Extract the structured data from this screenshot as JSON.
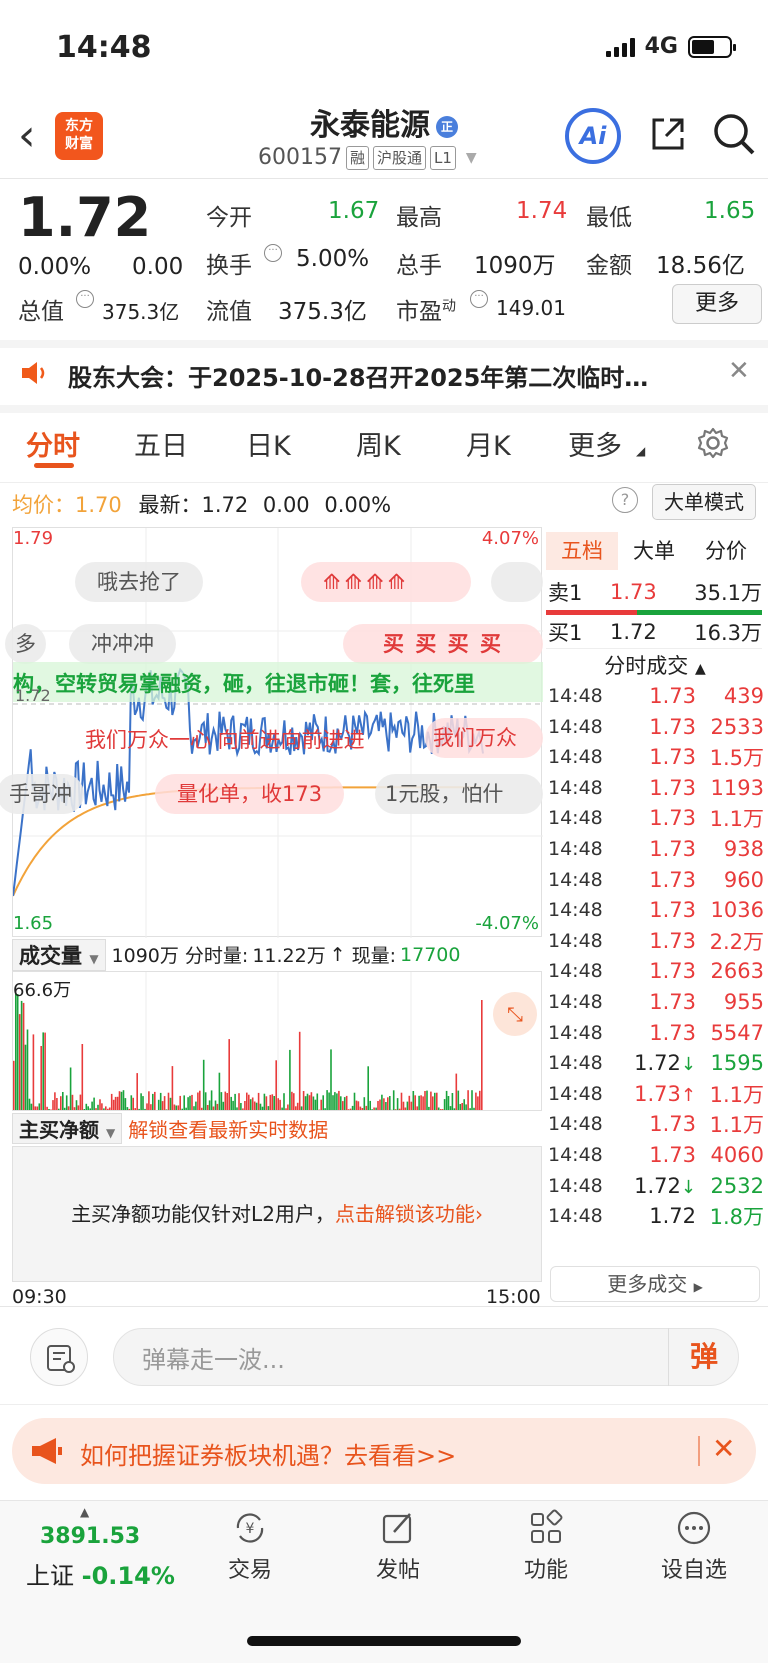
{
  "status": {
    "time": "14:48",
    "network": "4G"
  },
  "header": {
    "logo_line1": "东方",
    "logo_line2": "财富",
    "stock_name": "永泰能源",
    "name_badge": "正",
    "stock_code": "600157",
    "tags": [
      "融",
      "沪股通",
      "L1"
    ],
    "ai_label": "Ai"
  },
  "quote": {
    "price": "1.72",
    "change_pct": "0.00%",
    "change": "0.00",
    "open_label": "今开",
    "open": "1.67",
    "high_label": "最高",
    "high": "1.74",
    "low_label": "最低",
    "low": "1.65",
    "turnover_label": "换手",
    "turnover": "5.00%",
    "volume_label": "总手",
    "volume": "1090万",
    "amount_label": "金额",
    "amount": "18.56亿",
    "mktcap_label": "总值",
    "mktcap": "375.3亿",
    "float_label": "流值",
    "float": "375.3亿",
    "pe_label": "市盈",
    "pe_sup": "动",
    "pe": "149.01",
    "more_label": "更多"
  },
  "notice": {
    "text": "股东大会：于2025-10-28召开2025年第二次临时…"
  },
  "tabs": [
    "分时",
    "五日",
    "日K",
    "周K",
    "月K",
    "更多"
  ],
  "avg_row": {
    "avg_label": "均价：",
    "avg": "1.70",
    "latest_label": "最新：",
    "latest": "1.72",
    "chg": "0.00",
    "chg_pct": "0.00%"
  },
  "big_order_btn": "大单模式",
  "chart": {
    "y_max": "1.79",
    "y_min": "1.65",
    "pct_max": "4.07%",
    "pct_min": "-4.07%",
    "ref": "1.72",
    "time_start": "09:30",
    "time_end": "15:00"
  },
  "danmu": {
    "d1": "哦去抢了",
    "d2": "冲冲冲",
    "d3": "多",
    "d4": "量化单，收173",
    "d5": "1元股，怕什",
    "d6": "构，空转贸易掌融资，砸，往退市砸！套，往死里",
    "d7": "我们万众一心 向前进向前进进",
    "d8": "我们万众",
    "d9": "手哥冲",
    "d10_char": "买",
    "d11_char": "买"
  },
  "volume": {
    "selector": "成交量",
    "total": "1090万",
    "minute_label": "分时量:",
    "minute": "11.22万",
    "arrow": "↑",
    "now_label": "现量:",
    "now": "17700",
    "max": "66.6万"
  },
  "net_buy": {
    "selector": "主买净额",
    "unlock": "解锁查看最新实时数据",
    "msg": "主买净额功能仅针对L2用户，",
    "msg_link": "点击解锁该功能"
  },
  "right_panel": {
    "tabs": [
      "五档",
      "大单",
      "分价"
    ],
    "sell1_label": "卖1",
    "sell1_price": "1.73",
    "sell1_vol": "35.1万",
    "buy1_label": "买1",
    "buy1_price": "1.72",
    "buy1_vol": "16.3万",
    "ticks_title": "分时成交",
    "ticks": [
      {
        "t": "14:48",
        "p": "1.73",
        "v": "439",
        "c": "red",
        "a": ""
      },
      {
        "t": "14:48",
        "p": "1.73",
        "v": "2533",
        "c": "red",
        "a": ""
      },
      {
        "t": "14:48",
        "p": "1.73",
        "v": "1.5万",
        "c": "red",
        "a": ""
      },
      {
        "t": "14:48",
        "p": "1.73",
        "v": "1193",
        "c": "red",
        "a": ""
      },
      {
        "t": "14:48",
        "p": "1.73",
        "v": "1.1万",
        "c": "red",
        "a": ""
      },
      {
        "t": "14:48",
        "p": "1.73",
        "v": "938",
        "c": "red",
        "a": ""
      },
      {
        "t": "14:48",
        "p": "1.73",
        "v": "960",
        "c": "red",
        "a": ""
      },
      {
        "t": "14:48",
        "p": "1.73",
        "v": "1036",
        "c": "red",
        "a": ""
      },
      {
        "t": "14:48",
        "p": "1.73",
        "v": "2.2万",
        "c": "red",
        "a": ""
      },
      {
        "t": "14:48",
        "p": "1.73",
        "v": "2663",
        "c": "red",
        "a": ""
      },
      {
        "t": "14:48",
        "p": "1.73",
        "v": "955",
        "c": "red",
        "a": ""
      },
      {
        "t": "14:48",
        "p": "1.73",
        "v": "5547",
        "c": "red",
        "a": ""
      },
      {
        "t": "14:48",
        "p": "1.72",
        "v": "1595",
        "c": "green",
        "a": "↓"
      },
      {
        "t": "14:48",
        "p": "1.73",
        "v": "1.1万",
        "c": "red",
        "a": "↑"
      },
      {
        "t": "14:48",
        "p": "1.73",
        "v": "1.1万",
        "c": "red",
        "a": ""
      },
      {
        "t": "14:48",
        "p": "1.73",
        "v": "4060",
        "c": "red",
        "a": ""
      },
      {
        "t": "14:48",
        "p": "1.72",
        "v": "2532",
        "c": "green",
        "a": "↓"
      },
      {
        "t": "14:48",
        "p": "1.72",
        "v": "1.8万",
        "c": "green",
        "a": ""
      }
    ],
    "more_ticks": "更多成交"
  },
  "comment": {
    "placeholder": "弹幕走一波...",
    "button": "弹"
  },
  "promo": {
    "text": "如何把握证券板块机遇？去看看>>"
  },
  "bottom_nav": {
    "index_value": "3891.53",
    "index_name": "上证",
    "index_change": "-0.14%",
    "items": [
      "交易",
      "发帖",
      "功能",
      "设自选"
    ]
  },
  "colors": {
    "up": "#e83b3b",
    "down": "#1aa33c",
    "accent": "#e8541d"
  }
}
